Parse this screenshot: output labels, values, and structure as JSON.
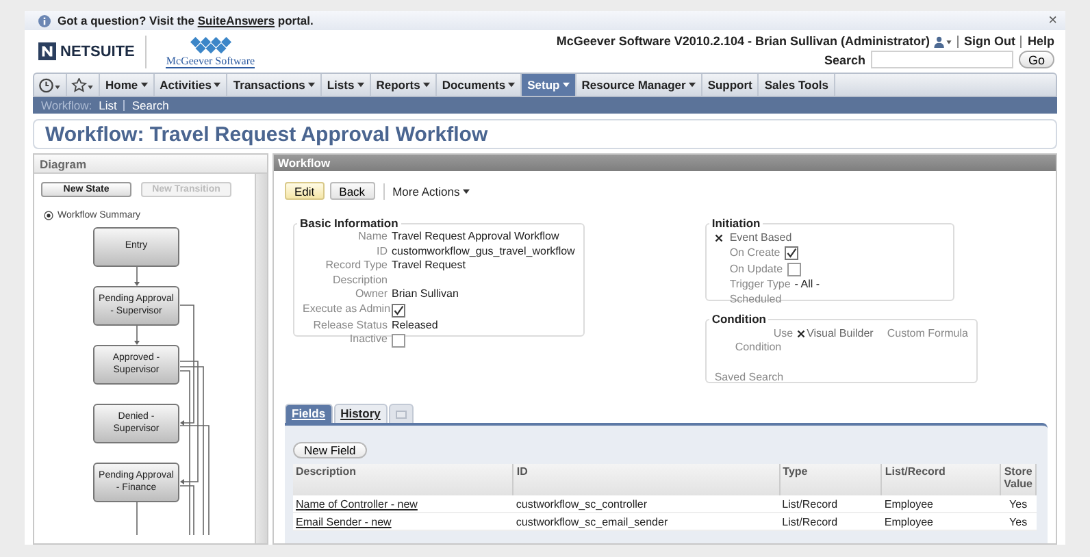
{
  "notice": {
    "text_before": "Got a question? Visit the",
    "link": "SuiteAnswers",
    "text_after": "portal.",
    "close": "×"
  },
  "header": {
    "logo": "NETSUITE",
    "partner_logo": "McGeever Software",
    "account": "McGeever Software V2010.2.104 - Brian Sullivan (Administrator)",
    "links": [
      "Sign Out",
      "Help"
    ],
    "search_label": "Search",
    "go": "Go"
  },
  "nav": [
    {
      "label": "Home",
      "dropdown": true,
      "selected": false
    },
    {
      "label": "Activities",
      "dropdown": true,
      "selected": false
    },
    {
      "label": "Transactions",
      "dropdown": true,
      "selected": false
    },
    {
      "label": "Lists",
      "dropdown": true,
      "selected": false
    },
    {
      "label": "Reports",
      "dropdown": true,
      "selected": false
    },
    {
      "label": "Documents",
      "dropdown": true,
      "selected": false
    },
    {
      "label": "Setup",
      "dropdown": true,
      "selected": true
    },
    {
      "label": "Resource Manager",
      "dropdown": true,
      "selected": false
    },
    {
      "label": "Support",
      "dropdown": false,
      "selected": false
    },
    {
      "label": "Sales Tools",
      "dropdown": false,
      "selected": false
    }
  ],
  "subnav": {
    "label": "Workflow:",
    "links": [
      "List",
      "Search"
    ]
  },
  "page_title": "Workflow: Travel Request Approval Workflow",
  "diagram": {
    "title": "Diagram",
    "buttons": [
      {
        "label": "New State",
        "disabled": false
      },
      {
        "label": "New Transition",
        "disabled": true
      }
    ],
    "summary": "Workflow Summary",
    "states": [
      "Entry",
      "Pending Approval - Supervisor",
      "Approved - Supervisor",
      "Denied - Supervisor",
      "Pending Approval - Finance"
    ]
  },
  "workflow": {
    "title": "Workflow",
    "buttons": [
      {
        "label": "Edit",
        "kind": "primary"
      },
      {
        "label": "Back",
        "kind": "normal"
      }
    ],
    "more_actions": "More Actions",
    "basic": {
      "title": "Basic Information",
      "fields": [
        {
          "label": "Name",
          "kind": "text",
          "value": "Travel Request Approval Workflow"
        },
        {
          "label": "ID",
          "kind": "text",
          "value": "customworkflow_gus_travel_workflow"
        },
        {
          "label": "Record Type",
          "kind": "text",
          "value": "Travel Request"
        },
        {
          "label": "Description",
          "kind": "text"
        },
        {
          "label": "Owner",
          "kind": "text",
          "value": "Brian Sullivan"
        },
        {
          "label": "Execute as Admin",
          "kind": "checkbox",
          "checked": true
        },
        {
          "label": "Release Status",
          "kind": "text",
          "value": "Released"
        },
        {
          "label": "Inactive",
          "kind": "checkbox",
          "checked": false
        }
      ]
    },
    "initiation": {
      "title": "Initiation",
      "options": [
        {
          "label": "Event Based",
          "selected": true,
          "details": [
            {
              "label": "On Create",
              "kind": "checkbox",
              "checked": true
            },
            {
              "label": "On Update",
              "kind": "checkbox",
              "checked": false
            },
            {
              "label": "Trigger Type",
              "kind": "text",
              "value": "- All -"
            }
          ]
        },
        {
          "label": "Scheduled",
          "selected": false
        }
      ]
    },
    "condition": {
      "title": "Condition",
      "use_label": "Use",
      "options": [
        {
          "label": "Visual Builder",
          "selected": true
        },
        {
          "label": "Custom Formula",
          "selected": false
        }
      ],
      "fields": [
        "Condition",
        "Saved Search"
      ]
    },
    "subtabs": [
      {
        "label": "Fields",
        "kind": "text",
        "selected": true
      },
      {
        "label": "History",
        "kind": "text",
        "selected": false
      },
      {
        "kind": "icon",
        "selected": false
      }
    ],
    "new_field": "New Field",
    "table": {
      "columns": [
        "Description",
        "ID",
        "Type",
        "List/Record",
        "Store Value"
      ],
      "rows": [
        [
          "Name of Controller - new",
          "custworkflow_sc_controller",
          "List/Record",
          "Employee",
          "Yes"
        ],
        [
          "Email Sender - new",
          "custworkflow_sc_email_sender",
          "List/Record",
          "Employee",
          "Yes"
        ]
      ]
    }
  }
}
